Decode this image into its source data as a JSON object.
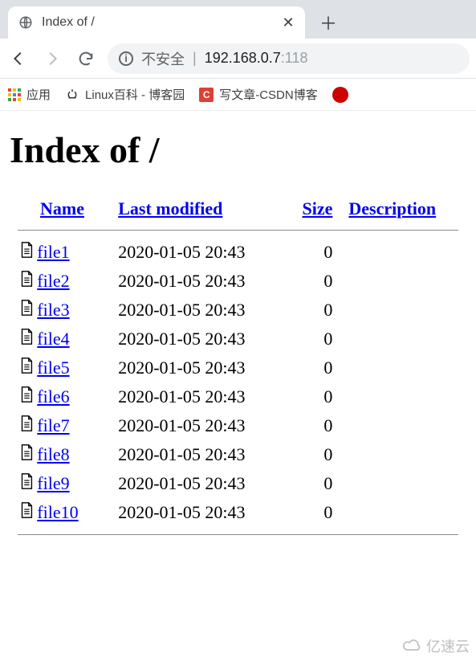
{
  "tab": {
    "title": "Index of /"
  },
  "addressbar": {
    "security_text": "不安全",
    "url_host": "192.168.0.7",
    "url_port": ":118"
  },
  "bookmarks": {
    "apps": "应用",
    "linux": "Linux百科 - 博客园",
    "csdn": "写文章-CSDN博客"
  },
  "page": {
    "heading": "Index of /",
    "columns": {
      "name": "Name",
      "modified": "Last modified",
      "size": "Size",
      "description": "Description"
    },
    "files": [
      {
        "name": "file1",
        "modified": "2020-01-05 20:43",
        "size": "0"
      },
      {
        "name": "file2",
        "modified": "2020-01-05 20:43",
        "size": "0"
      },
      {
        "name": "file3",
        "modified": "2020-01-05 20:43",
        "size": "0"
      },
      {
        "name": "file4",
        "modified": "2020-01-05 20:43",
        "size": "0"
      },
      {
        "name": "file5",
        "modified": "2020-01-05 20:43",
        "size": "0"
      },
      {
        "name": "file6",
        "modified": "2020-01-05 20:43",
        "size": "0"
      },
      {
        "name": "file7",
        "modified": "2020-01-05 20:43",
        "size": "0"
      },
      {
        "name": "file8",
        "modified": "2020-01-05 20:43",
        "size": "0"
      },
      {
        "name": "file9",
        "modified": "2020-01-05 20:43",
        "size": "0"
      },
      {
        "name": "file10",
        "modified": "2020-01-05 20:43",
        "size": "0"
      }
    ]
  },
  "watermark": "亿速云"
}
